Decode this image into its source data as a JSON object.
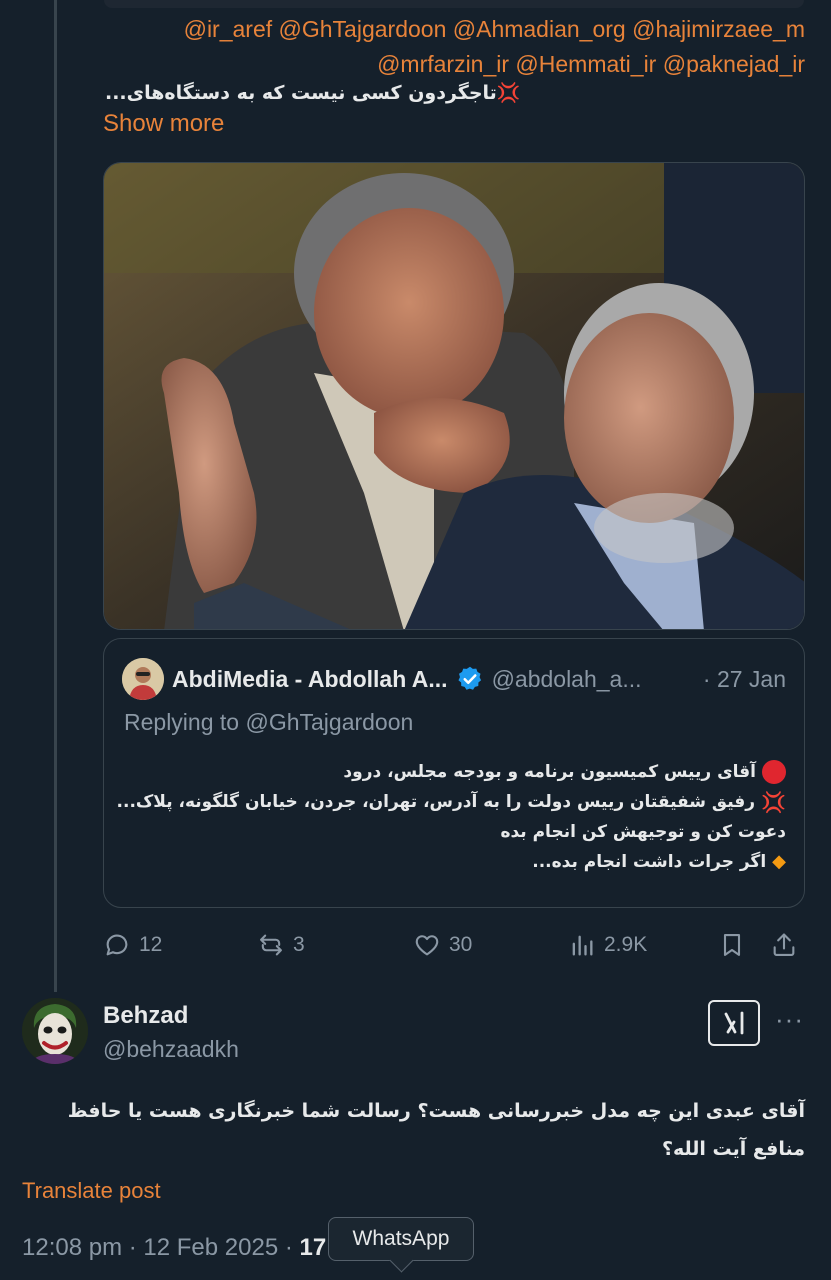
{
  "thread": {
    "mentions_line1": "@ir_aref @GhTajgardoon @Ahmadian_org @hajimirzaee_m",
    "mentions_line2": "@mrfarzin_ir @Hemmati_ir @paknejad_ir",
    "text_fa": "💢تاجگردون کسی نیست که به دستگاه‌های...",
    "show_more": "Show more"
  },
  "quote": {
    "name": "AbdiMedia - Abdollah A...",
    "handle": "@abdolah_a...",
    "date": "· 27 Jan",
    "replying_to_prefix": "Replying to ",
    "replying_to_handle": "@GhTajgardoon",
    "line1": "آقای رییس کمیسیون برنامه و بودجه مجلس، درود",
    "line2": "رفیق شفیقتان رییس دولت را به آدرس، تهران، جردن، خیابان گلگونه، پلاک...",
    "line3": "دعوت کن و توجیهش کن انجام بده",
    "line4": "اگر جرات داشت انجام بده..."
  },
  "actions": {
    "replies": "12",
    "reposts": "3",
    "likes": "30",
    "views": "2.9K"
  },
  "reply": {
    "name": "Behzad",
    "handle": "@behzaadkh",
    "text": "آقای عبدی این چه مدل خبررسانی هست؟ رسالت شما خبرنگاری هست یا حافظ منافع آیت الله؟",
    "translate": "Translate post",
    "timestamp": "12:08 pm · 12 Feb 2025 · ",
    "views_partial": "17",
    "tooltip": "WhatsApp"
  },
  "colors": {
    "background": "#15202b",
    "accent": "#e8833a",
    "muted": "#8b98a5",
    "verified": "#1d9bf0"
  }
}
